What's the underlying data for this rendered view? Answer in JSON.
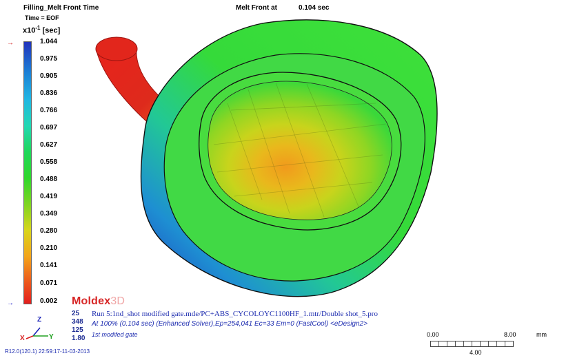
{
  "header": {
    "title": "Filling_Melt Front Time",
    "time_line": "Time = EOF",
    "scale_prefix": "x10",
    "scale_exponent": "-1",
    "scale_unit": "[sec]",
    "melt_front_label": "Melt Front at",
    "melt_front_value": "0.104 sec"
  },
  "colorbar": {
    "ticks": [
      "1.044",
      "0.975",
      "0.905",
      "0.836",
      "0.766",
      "0.697",
      "0.627",
      "0.558",
      "0.488",
      "0.419",
      "0.349",
      "0.280",
      "0.210",
      "0.141",
      "0.071",
      "0.002"
    ],
    "top_marker": "→",
    "bottom_marker": "→",
    "colors": [
      "#2233bb",
      "#1c82d6",
      "#21b6e2",
      "#22d7b3",
      "#1fd65a",
      "#2fd62c",
      "#7ed421",
      "#d8d51b",
      "#f3a41a",
      "#ec5d1c",
      "#e21e1e"
    ]
  },
  "logo": {
    "main": "Moldex",
    "suffix": "3D"
  },
  "stats": [
    "25",
    "348",
    "125",
    "1.80"
  ],
  "info": {
    "run_line": "Run 5:1nd_shot modified gate.mde/PC+ABS_CYCOLOYC1100HF_1.mtr/Double shot_5.pro",
    "at_line": "At 100% (0.104 sec) (Enhanced Solver),Ep=254,041 Ec=33 Em=0 (FastCool) <eDesign2>",
    "gate_line": "1st modifed gate"
  },
  "build": "R12.0(120.1) 22:59:17-11-03-2013",
  "axes": {
    "z": "Z",
    "y": "Y",
    "x": "X",
    "z_color": "#1a23b8",
    "y_color": "#20a020",
    "x_color": "#d81d1d"
  },
  "ruler": {
    "start": "0.00",
    "end": "8.00",
    "unit": "mm",
    "mid": "4.00"
  }
}
